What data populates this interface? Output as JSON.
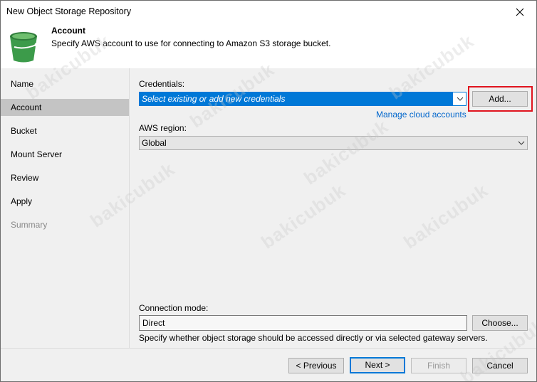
{
  "window": {
    "title": "New Object Storage Repository",
    "close_icon": "close-icon"
  },
  "header": {
    "title": "Account",
    "description": "Specify AWS account to use for connecting to Amazon S3 storage bucket.",
    "icon": "bucket-icon",
    "icon_color": "#3c9b4a"
  },
  "steps": [
    {
      "label": "Name",
      "state": "done"
    },
    {
      "label": "Account",
      "state": "active"
    },
    {
      "label": "Bucket",
      "state": "pending"
    },
    {
      "label": "Mount Server",
      "state": "pending"
    },
    {
      "label": "Review",
      "state": "pending"
    },
    {
      "label": "Apply",
      "state": "pending"
    },
    {
      "label": "Summary",
      "state": "disabled"
    }
  ],
  "credentials": {
    "label": "Credentials:",
    "value": "Select existing or add new credentials",
    "add_button": "Add...",
    "manage_link": "Manage cloud accounts"
  },
  "region": {
    "label": "AWS region:",
    "value": "Global"
  },
  "connection": {
    "label": "Connection mode:",
    "value": "Direct",
    "choose_button": "Choose...",
    "hint": "Specify whether object storage should be accessed directly or via selected gateway servers."
  },
  "footer": {
    "previous": "< Previous",
    "next": "Next >",
    "finish": "Finish",
    "cancel": "Cancel"
  },
  "watermark": "bakicubuk",
  "colors": {
    "accent": "#0078d7",
    "highlight": "#e0141e",
    "link": "#0066cc"
  }
}
